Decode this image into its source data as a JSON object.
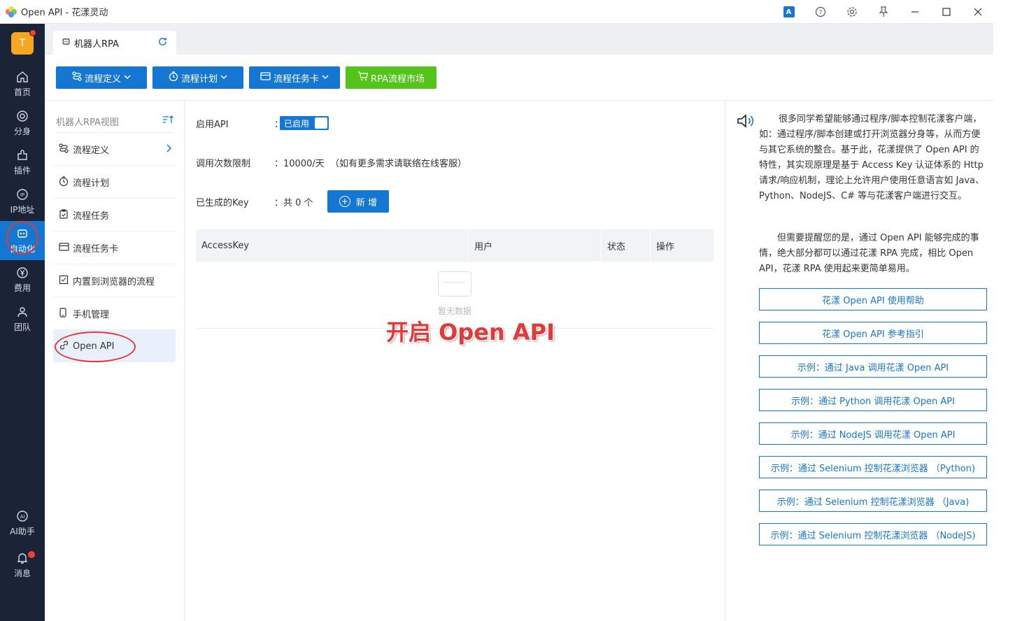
{
  "window": {
    "title": "Open API - 花漾灵动",
    "icons": [
      "translate-icon",
      "help-icon",
      "settings-icon",
      "pin-icon",
      "minimize-icon",
      "maximize-icon",
      "close-icon"
    ],
    "translate_label": "A"
  },
  "rail": {
    "avatar_initial": "T",
    "items": [
      {
        "label": "首页",
        "icon": "home-icon"
      },
      {
        "label": "分身",
        "icon": "profile-icon"
      },
      {
        "label": "插件",
        "icon": "plugin-icon"
      },
      {
        "label": "IP地址",
        "icon": "ip-icon"
      },
      {
        "label": "自动化",
        "icon": "robot-icon",
        "active": true
      },
      {
        "label": "费用",
        "icon": "yen-icon"
      },
      {
        "label": "团队",
        "icon": "team-icon"
      }
    ],
    "bottom_items": [
      {
        "label": "AI助手",
        "icon": "ai-icon"
      },
      {
        "label": "消息",
        "icon": "bell-icon"
      }
    ]
  },
  "tabstrip": {
    "tab_label": "机器人RPA"
  },
  "toolbar": {
    "buttons": [
      {
        "label": "流程定义",
        "icon": "flow-icon",
        "dropdown": true
      },
      {
        "label": "流程计划",
        "icon": "clock-icon",
        "dropdown": true
      },
      {
        "label": "流程任务卡",
        "icon": "card-icon",
        "dropdown": true
      },
      {
        "label": "RPA流程市场",
        "icon": "cart-icon",
        "dropdown": false
      }
    ]
  },
  "nav": {
    "header": "机器人RPA视图",
    "items": [
      {
        "label": "流程定义",
        "icon": "flow-icon"
      },
      {
        "label": "流程计划",
        "icon": "clock-icon"
      },
      {
        "label": "流程任务",
        "icon": "clipboard-icon"
      },
      {
        "label": "流程任务卡",
        "icon": "card-icon"
      },
      {
        "label": "内置到浏览器的流程",
        "icon": "checkbox-icon"
      },
      {
        "label": "手机管理",
        "icon": "phone-icon"
      },
      {
        "label": "Open API",
        "icon": "link-icon",
        "active": true
      }
    ]
  },
  "main": {
    "enable_api_label": "启用API",
    "enable_api_value": "已启用",
    "limit_label": "调用次数限制",
    "limit_value": "：10000/天  （如有更多需求请联络在线客服）",
    "keys_label": "已生成的Key",
    "keys_value": "：共 0 个",
    "add_button": "新 增",
    "colon": "：",
    "table": {
      "columns": [
        "AccessKey",
        "用户",
        "状态",
        "操作"
      ],
      "empty_text": "暂无数据"
    },
    "overlay_title": "开启 Open API"
  },
  "right": {
    "paragraph1": "很多同学希望能够通过程序/脚本控制花漾客户端，如：通过程序/脚本创建或打开浏览器分身等，从而方便与其它系统的整合。基于此，花漾提供了 Open API 的特性，其实现原理是基于 Access Key 认证体系的 Http 请求/响应机制，理论上允许用户使用任意语言如 Java、Python、NodeJS、C# 等与花漾客户端进行交互。",
    "paragraph2": "但需要提醒您的是，通过 Open API 能够完成的事情，绝大部分都可以通过花漾 RPA 完成，相比 Open API，花漾 RPA 使用起来更简单易用。",
    "links": [
      "花漾 Open API 使用帮助",
      "花漾 Open API 参考指引",
      "示例：通过 Java 调用花漾 Open API",
      "示例：通过 Python 调用花漾 Open API",
      "示例：通过 NodeJS 调用花漾 Open API",
      "示例：通过 Selenium 控制花漾浏览器 （Python)",
      "示例：通过 Selenium 控制花漾浏览器 （Java)",
      "示例：通过 Selenium 控制花漾浏览器 （NodeJS)"
    ]
  },
  "colors": {
    "primary": "#1677d2",
    "green": "#52c41a",
    "rail_bg": "#1b2437",
    "annotation_red": "#e03a3a"
  }
}
